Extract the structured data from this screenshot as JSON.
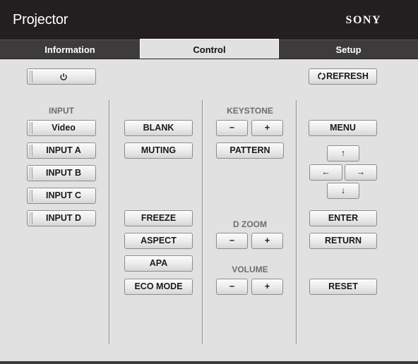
{
  "header": {
    "title": "Projector",
    "brand": "SONY"
  },
  "tabs": [
    {
      "label": "Information",
      "active": false
    },
    {
      "label": "Control",
      "active": true
    },
    {
      "label": "Setup",
      "active": false
    }
  ],
  "power": {
    "icon": "power-icon"
  },
  "refresh": {
    "icon": "refresh-icon",
    "label": "REFRESH"
  },
  "input": {
    "heading": "INPUT",
    "buttons": [
      "Video",
      "INPUT A",
      "INPUT B",
      "INPUT C",
      "INPUT D"
    ]
  },
  "picture": {
    "blank": "BLANK",
    "muting": "MUTING",
    "freeze": "FREEZE",
    "aspect": "ASPECT",
    "apa": "APA",
    "eco_mode": "ECO MODE"
  },
  "keystone": {
    "heading": "KEYSTONE",
    "minus": "−",
    "plus": "+"
  },
  "pattern": "PATTERN",
  "dzoom": {
    "heading": "D ZOOM",
    "minus": "−",
    "plus": "+"
  },
  "volume": {
    "heading": "VOLUME",
    "minus": "−",
    "plus": "+"
  },
  "navigation": {
    "menu": "MENU",
    "up": "↑",
    "left": "←",
    "right": "→",
    "down": "↓",
    "enter": "ENTER",
    "return": "RETURN",
    "reset": "RESET"
  }
}
